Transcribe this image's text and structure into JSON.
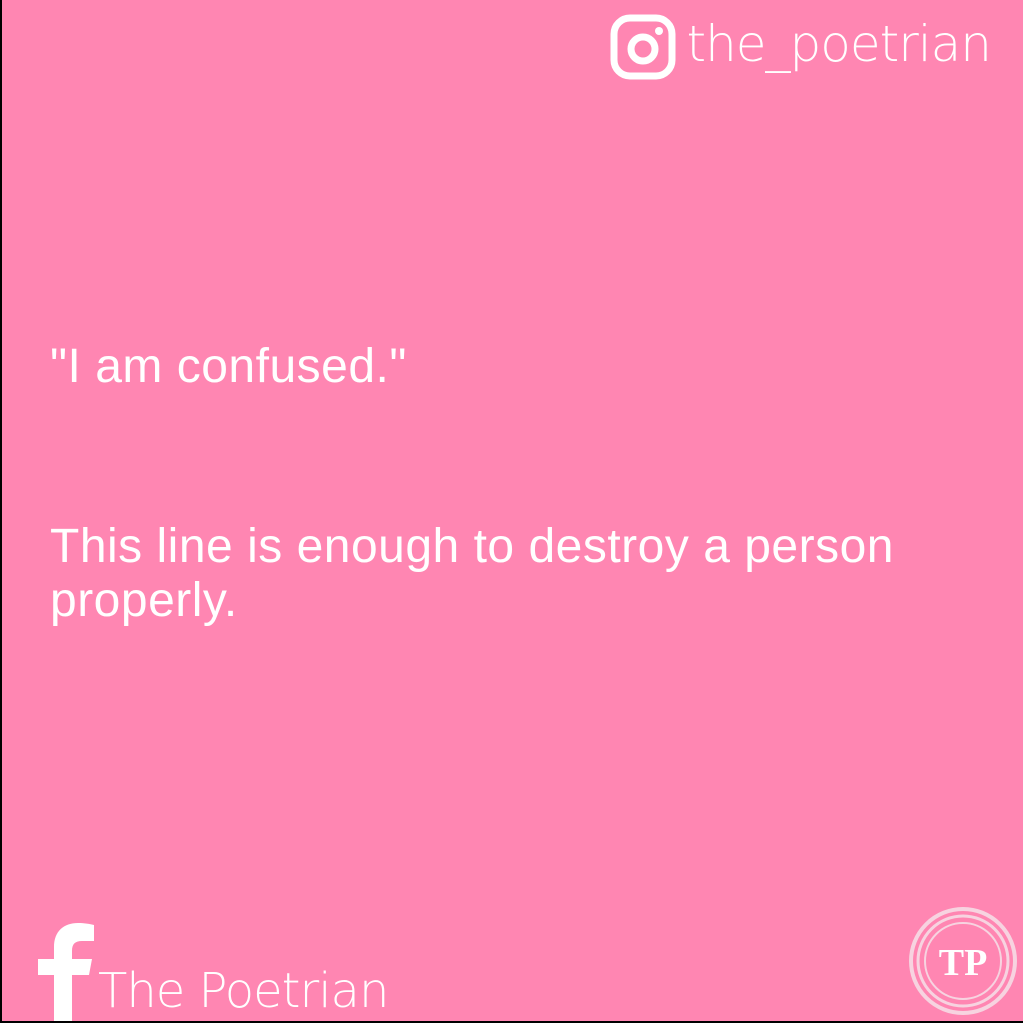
{
  "instagram": {
    "icon": "instagram-icon",
    "handle": "the_poetrian"
  },
  "quote": {
    "line1": "\"I am confused.\"",
    "line2": "This line is enough to destroy a person properly."
  },
  "facebook": {
    "icon": "facebook-icon",
    "name": "The Poetrian"
  },
  "logo": {
    "text": "TP"
  },
  "colors": {
    "background": "#ff86b2",
    "text": "#ffffff",
    "logo_ring": "#f7d3e0"
  }
}
